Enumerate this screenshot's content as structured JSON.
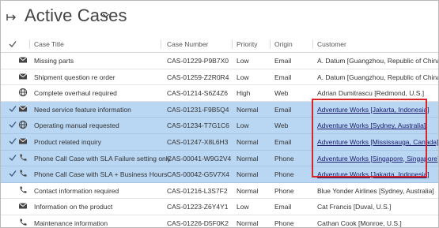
{
  "view": {
    "title": "Active Cases"
  },
  "columns": {
    "title": "Case Title",
    "number": "Case Number",
    "priority": "Priority",
    "origin": "Origin",
    "customer": "Customer"
  },
  "rows": [
    {
      "icon": "email-icon",
      "selected": false,
      "title": "Missing parts",
      "number": "CAS-01229-P9B7X0",
      "priority": "Low",
      "origin": "Email",
      "customer": "A. Datum [Guangzhou, Republic of China]"
    },
    {
      "icon": "email-icon",
      "selected": false,
      "title": "Shipment question re order",
      "number": "CAS-01259-Z2R0R4",
      "priority": "Low",
      "origin": "Email",
      "customer": "A. Datum [Guangzhou, Republic of China]"
    },
    {
      "icon": "globe-icon",
      "selected": false,
      "title": "Complete overhaul required",
      "number": "CAS-01214-S6Z4Z6",
      "priority": "High",
      "origin": "Web",
      "customer": "Adrian Dumitrascu [Redmond, U.S.]"
    },
    {
      "icon": "email-icon",
      "selected": true,
      "title": "Need service feature information",
      "number": "CAS-01231-F9B5Q4",
      "priority": "Normal",
      "origin": "Email",
      "customer": "Adventure Works [Jakarta, Indonesia]"
    },
    {
      "icon": "globe-icon",
      "selected": true,
      "title": "Operating manual requested",
      "number": "CAS-01234-T7G1C6",
      "priority": "Low",
      "origin": "Web",
      "customer": "Adventure Works [Sydney, Australia]"
    },
    {
      "icon": "email-icon",
      "selected": true,
      "title": "Product related inquiry",
      "number": "CAS-01247-X8L6H3",
      "priority": "Normal",
      "origin": "Email",
      "customer": "Adventure Works [Mississauga, Canada]"
    },
    {
      "icon": "phone-icon",
      "selected": true,
      "title": "Phone Call Case with SLA Failure setting only",
      "number": "CAS-00041-W9G2V4",
      "priority": "Normal",
      "origin": "Phone",
      "customer": "Adventure Works [Singapore, Singapore]"
    },
    {
      "icon": "phone-icon",
      "selected": true,
      "title": "Phone Call Case with SLA + Business Hours",
      "number": "CAS-00042-G5V7X4",
      "priority": "Normal",
      "origin": "Phone",
      "customer": "Adventure Works [Jakarta, Indonesia]"
    },
    {
      "icon": "phone-icon",
      "selected": false,
      "title": "Contact information required",
      "number": "CAS-01216-L3S7F2",
      "priority": "Normal",
      "origin": "Phone",
      "customer": "Blue Yonder Airlines [Sydney, Australia]"
    },
    {
      "icon": "email-icon",
      "selected": false,
      "title": "Information on the product",
      "number": "CAS-01223-Z6Y4Y1",
      "priority": "Low",
      "origin": "Email",
      "customer": "Cat Francis [Duval, U.S.]"
    },
    {
      "icon": "phone-icon",
      "selected": false,
      "title": "Maintenance information",
      "number": "CAS-01226-D5F0K2",
      "priority": "Normal",
      "origin": "Phone",
      "customer": "Cathan Cook [Monroe, U.S.]"
    }
  ],
  "colors": {
    "selected_row": "#b9d6f2",
    "highlight_box": "#d6262b"
  }
}
